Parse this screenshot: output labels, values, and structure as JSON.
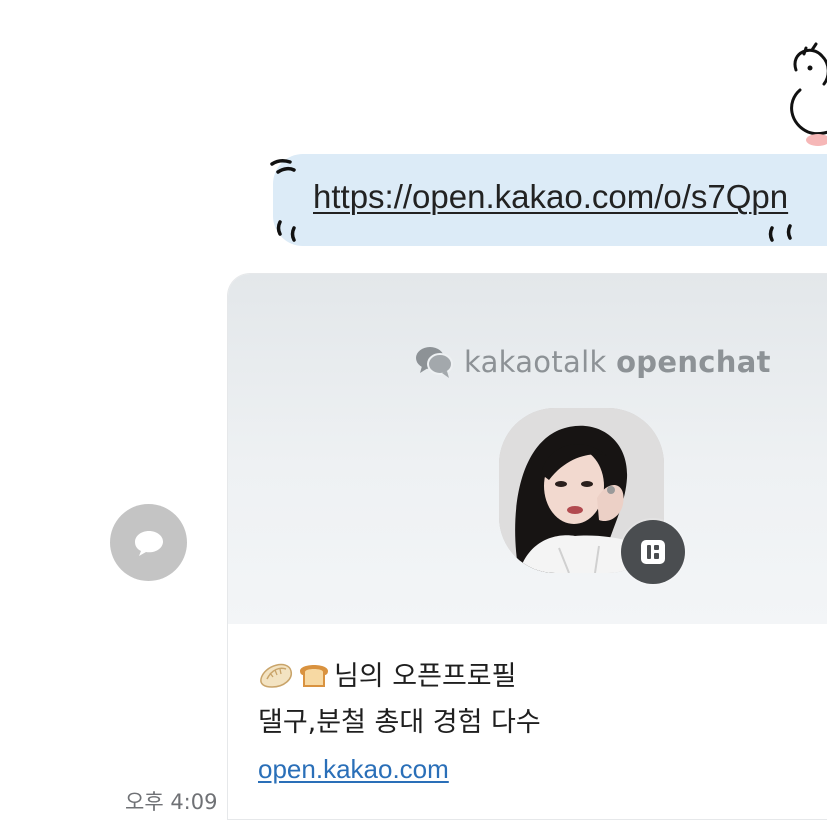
{
  "message": {
    "link_url": "https://open.kakao.com/o/s7Qpn",
    "timestamp": "오후 4:09"
  },
  "preview_card": {
    "brand_regular": "kakaotalk ",
    "brand_bold": "openchat",
    "emoji": [
      "dumpling",
      "bread"
    ],
    "title": "님의 오픈프로필",
    "description": "댈구,분철 총대 경험 다수",
    "domain": "open.kakao.com"
  },
  "icons": {
    "share": "speech-bubble-icon",
    "brand_logo": "openchat-logo-icon",
    "profile_badge": "openprofile-badge-icon"
  },
  "colors": {
    "bubble": "#dcebf7",
    "link": "#2a6fb8",
    "share_button": "#c4c4c4",
    "badge": "#4a4d50"
  }
}
